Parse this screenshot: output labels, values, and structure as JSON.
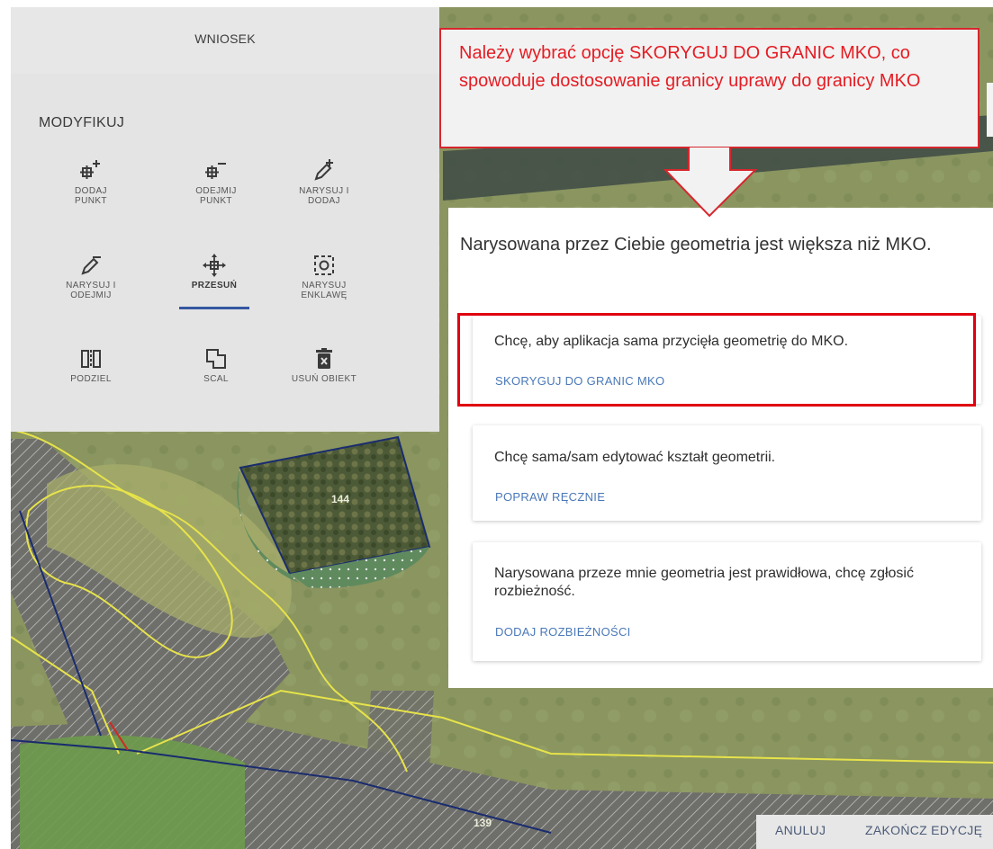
{
  "panel": {
    "tab_label": "WNIOSEK",
    "section_title": "MODYFIKUJ",
    "tools": [
      {
        "icon": "add-point-icon",
        "line1": "DODAJ",
        "line2": "PUNKT",
        "active": false
      },
      {
        "icon": "remove-point-icon",
        "line1": "ODEJMIJ",
        "line2": "PUNKT",
        "active": false
      },
      {
        "icon": "draw-add-icon",
        "line1": "NARYSUJ I",
        "line2": "DODAJ",
        "active": false
      },
      {
        "icon": "draw-subtract-icon",
        "line1": "NARYSUJ I",
        "line2": "ODEJMIJ",
        "active": false
      },
      {
        "icon": "move-icon",
        "line1": "PRZESUŃ",
        "line2": "",
        "active": true
      },
      {
        "icon": "enclave-icon",
        "line1": "NARYSUJ",
        "line2": "ENKLAWĘ",
        "active": false
      },
      {
        "icon": "split-icon",
        "line1": "PODZIEL",
        "line2": "",
        "active": false
      },
      {
        "icon": "merge-icon",
        "line1": "SCAL",
        "line2": "",
        "active": false
      },
      {
        "icon": "delete-icon",
        "line1": "USUŃ OBIEKT",
        "line2": "",
        "active": false
      }
    ]
  },
  "callout": {
    "text": "Należy wybrać opcję SKORYGUJ DO GRANIC MKO, co spowoduje dostosowanie granicy uprawy do granicy MKO"
  },
  "dialog": {
    "title": "Narysowana przez Ciebie geometria jest większa niż MKO.",
    "options": [
      {
        "text": "Chcę, aby aplikacja sama przycięła geometrię do MKO.",
        "action": "SKORYGUJ DO GRANIC MKO"
      },
      {
        "text": "Chcę sama/sam edytować kształt geometrii.",
        "action": "POPRAW RĘCZNIE"
      },
      {
        "text": "Narysowana przeze mnie geometria jest prawidłowa, chcę zgłosić rozbieżność.",
        "action": "DODAJ ROZBIEŻNOŚCI"
      }
    ]
  },
  "map": {
    "parcel_labels": [
      "144",
      "139"
    ]
  },
  "bottom_bar": {
    "cancel": "ANULUJ",
    "finish": "ZAKOŃCZ EDYCJĘ"
  },
  "colors": {
    "accent_blue": "#4a78b8",
    "highlight_red": "#e0000f",
    "parcel_yellow": "#e7e34a",
    "parcel_navy": "#1a2c6e"
  }
}
